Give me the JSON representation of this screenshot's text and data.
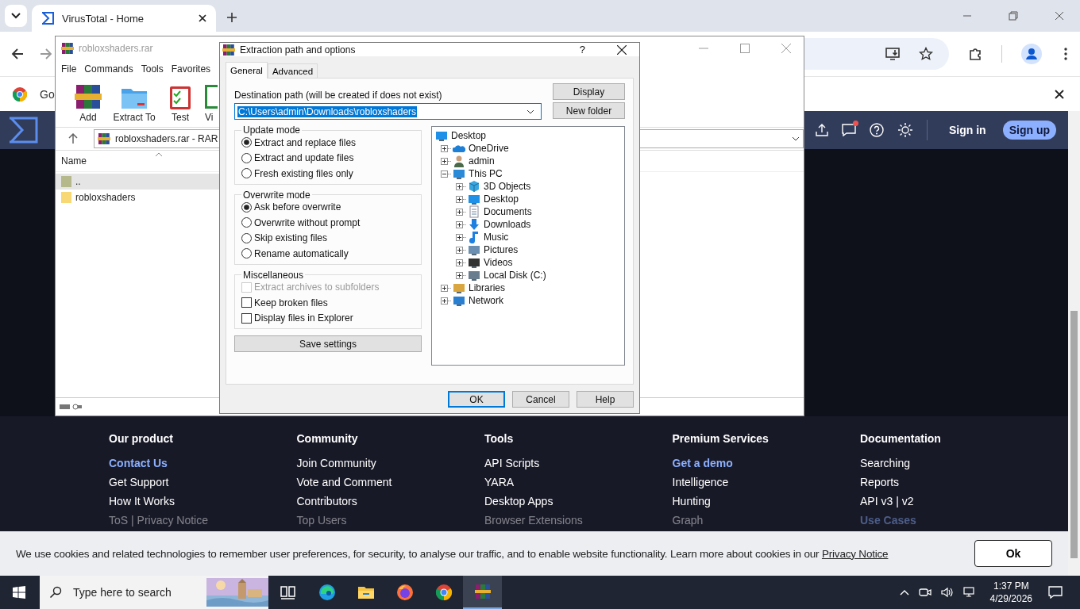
{
  "browser": {
    "tabs": [
      {
        "title": "VirusTotal - Home",
        "selected": true
      }
    ],
    "infobar": {
      "text": "Go"
    }
  },
  "site": {
    "header": {
      "sign_in": "Sign in",
      "sign_up": "Sign up",
      "notification": true
    },
    "footer": {
      "columns": [
        {
          "heading": "Our product",
          "links": [
            {
              "text": "Contact Us",
              "kind": "accent"
            },
            {
              "text": "Get Support",
              "kind": "plain"
            },
            {
              "text": "How It Works",
              "kind": "plain"
            },
            {
              "text": "ToS | Privacy Notice",
              "kind": "faded"
            }
          ]
        },
        {
          "heading": "Community",
          "links": [
            {
              "text": "Join Community",
              "kind": "plain"
            },
            {
              "text": "Vote and Comment",
              "kind": "plain"
            },
            {
              "text": "Contributors",
              "kind": "plain"
            },
            {
              "text": "Top Users",
              "kind": "faded"
            }
          ]
        },
        {
          "heading": "Tools",
          "links": [
            {
              "text": "API Scripts",
              "kind": "plain"
            },
            {
              "text": "YARA",
              "kind": "plain"
            },
            {
              "text": "Desktop Apps",
              "kind": "plain"
            },
            {
              "text": "Browser Extensions",
              "kind": "faded"
            }
          ]
        },
        {
          "heading": "Premium Services",
          "links": [
            {
              "text": "Get a demo",
              "kind": "accent"
            },
            {
              "text": "Intelligence",
              "kind": "plain"
            },
            {
              "text": "Hunting",
              "kind": "plain"
            },
            {
              "text": "Graph",
              "kind": "faded"
            }
          ]
        },
        {
          "heading": "Documentation",
          "links": [
            {
              "text": "Searching",
              "kind": "plain"
            },
            {
              "text": "Reports",
              "kind": "plain"
            },
            {
              "text": "API v3 | v2",
              "kind": "plain"
            },
            {
              "text": "Use Cases",
              "kind": "faded-accent"
            }
          ]
        }
      ]
    },
    "cookie_banner": {
      "text": "We use cookies and related technologies to remember user preferences, for security, to analyse our traffic, and to enable website functionality. Learn more about cookies in our",
      "link": "Privacy Notice",
      "button": "Ok"
    }
  },
  "winrar": {
    "title": "robloxshaders.rar",
    "menu": [
      "File",
      "Commands",
      "Tools",
      "Favorites"
    ],
    "toolbar": [
      {
        "label": "Add",
        "kind": "add"
      },
      {
        "label": "Extract To",
        "kind": "extract"
      },
      {
        "label": "Test",
        "kind": "test"
      },
      {
        "label": "Vi",
        "kind": "view"
      }
    ],
    "address": "robloxshaders.rar - RAR",
    "column": "Name",
    "files": [
      {
        "name": "..",
        "kind": "up",
        "selected": true
      },
      {
        "name": "robloxshaders",
        "kind": "folder",
        "selected": false
      }
    ]
  },
  "dialog": {
    "title": "Extraction path and options",
    "help": "?",
    "tabs": [
      {
        "label": "General",
        "selected": true
      },
      {
        "label": "Advanced",
        "selected": false
      }
    ],
    "destination": {
      "label": "Destination path (will be created if does not exist)",
      "value": "C:\\Users\\admin\\Downloads\\robloxshaders"
    },
    "side_buttons": [
      "Display",
      "New folder"
    ],
    "groups": [
      {
        "title": "Update mode",
        "kind": "radio",
        "options": [
          {
            "label": "Extract and replace files",
            "selected": true
          },
          {
            "label": "Extract and update files",
            "selected": false
          },
          {
            "label": "Fresh existing files only",
            "selected": false
          }
        ]
      },
      {
        "title": "Overwrite mode",
        "kind": "radio",
        "options": [
          {
            "label": "Ask before overwrite",
            "selected": true
          },
          {
            "label": "Overwrite without prompt",
            "selected": false
          },
          {
            "label": "Skip existing files",
            "selected": false
          },
          {
            "label": "Rename automatically",
            "selected": false
          }
        ]
      },
      {
        "title": "Miscellaneous",
        "kind": "check",
        "options": [
          {
            "label": "Extract archives to subfolders",
            "checked": false,
            "disabled": true
          },
          {
            "label": "Keep broken files",
            "checked": false,
            "disabled": false
          },
          {
            "label": "Display files in Explorer",
            "checked": false,
            "disabled": false
          }
        ]
      }
    ],
    "save_button": "Save settings",
    "tree": [
      {
        "label": "Desktop",
        "kind": "desktop",
        "children": [
          {
            "label": "OneDrive",
            "kind": "cloud",
            "expanded": false
          },
          {
            "label": "admin",
            "kind": "user",
            "expanded": false
          },
          {
            "label": "This PC",
            "kind": "pc",
            "expanded": true,
            "children": [
              {
                "label": "3D Objects",
                "kind": "cube",
                "expanded": false
              },
              {
                "label": "Desktop",
                "kind": "desktop",
                "expanded": false
              },
              {
                "label": "Documents",
                "kind": "documents",
                "expanded": false
              },
              {
                "label": "Downloads",
                "kind": "downloads",
                "expanded": false
              },
              {
                "label": "Music",
                "kind": "music",
                "expanded": false
              },
              {
                "label": "Pictures",
                "kind": "pictures",
                "expanded": false
              },
              {
                "label": "Videos",
                "kind": "videos",
                "expanded": false
              },
              {
                "label": "Local Disk (C:)",
                "kind": "disk",
                "expanded": false
              }
            ]
          },
          {
            "label": "Libraries",
            "kind": "libraries",
            "expanded": false
          },
          {
            "label": "Network",
            "kind": "network",
            "expanded": false
          }
        ]
      }
    ],
    "buttons": [
      {
        "label": "OK",
        "default": true
      },
      {
        "label": "Cancel",
        "default": false
      },
      {
        "label": "Help",
        "default": false
      }
    ]
  },
  "taskbar": {
    "search_placeholder": "Type here to search",
    "apps": [
      {
        "kind": "taskview",
        "active": false
      },
      {
        "kind": "edge",
        "active": false
      },
      {
        "kind": "explorer",
        "active": false
      },
      {
        "kind": "firefox",
        "active": false
      },
      {
        "kind": "chrome",
        "active": false
      },
      {
        "kind": "winrar",
        "active": true
      }
    ],
    "time": "1:37 PM",
    "date": "4/29/2026"
  }
}
